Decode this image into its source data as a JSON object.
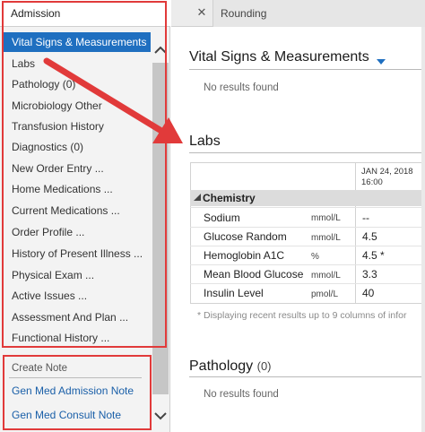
{
  "left_panel": {
    "tab_label": "Admission",
    "nav_items": [
      {
        "label": "Vital Signs & Measurements",
        "selected": true
      },
      {
        "label": "Labs"
      },
      {
        "label": "Pathology (0)"
      },
      {
        "label": "Microbiology Other"
      },
      {
        "label": "Transfusion History"
      },
      {
        "label": "Diagnostics (0)"
      },
      {
        "label": "New Order Entry ..."
      },
      {
        "label": "Home Medications ..."
      },
      {
        "label": "Current Medications ..."
      },
      {
        "label": "Order Profile ..."
      },
      {
        "label": "History of Present Illness ..."
      },
      {
        "label": "Physical Exam ..."
      },
      {
        "label": "Active Issues ..."
      },
      {
        "label": "Assessment And Plan ..."
      },
      {
        "label": "Functional History ..."
      }
    ],
    "create_note": {
      "label": "Create Note",
      "links": [
        "Gen Med Admission Note",
        "Gen Med Consult Note"
      ]
    }
  },
  "tabs": {
    "close_glyph": "✕",
    "rounding_label": "Rounding"
  },
  "sections": {
    "vital_signs": {
      "title": "Vital Signs & Measurements",
      "empty_text": "No results found"
    },
    "labs": {
      "title": "Labs",
      "date_header": [
        "JAN 24, 2018",
        "16:00"
      ],
      "group": "Chemistry",
      "rows": [
        {
          "name": "Sodium",
          "unit": "mmol/L",
          "value": "--"
        },
        {
          "name": "Glucose Random",
          "unit": "mmol/L",
          "value": "4.5"
        },
        {
          "name": "Hemoglobin A1C",
          "unit": "%",
          "value": "4.5 *"
        },
        {
          "name": "Mean Blood Glucose",
          "unit": "mmol/L",
          "value": "3.3"
        },
        {
          "name": "Insulin Level",
          "unit": "pmol/L",
          "value": "40"
        }
      ],
      "footnote": "* Displaying recent results up to 9 columns of infor"
    },
    "pathology": {
      "title": "Pathology",
      "count": "(0)",
      "empty_text": "No results found"
    }
  },
  "colors": {
    "selected_bg": "#1f6fc0",
    "highlight_red": "#e13a3a",
    "link_blue": "#1a5fa8"
  }
}
